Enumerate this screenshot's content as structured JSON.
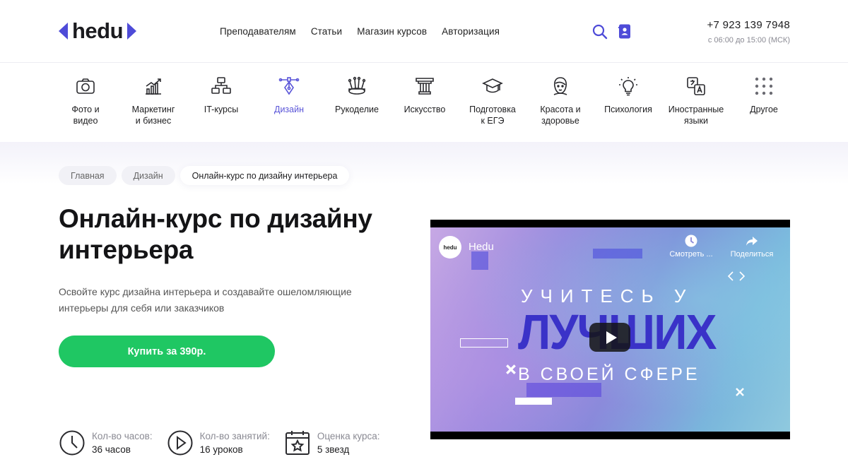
{
  "header": {
    "logo_text": "hedu",
    "nav": [
      "Преподавателям",
      "Статьи",
      "Магазин курсов",
      "Авторизация"
    ],
    "phone": "+7 923 139 7948",
    "hours": "с 06:00 до 15:00 (МСК)",
    "accent_color": "#4e4bd8"
  },
  "categories": [
    {
      "label": "Фото и\nвидео",
      "icon": "camera-icon"
    },
    {
      "label": "Маркетинг\nи бизнес",
      "icon": "growth-chart-icon"
    },
    {
      "label": "IT-курсы",
      "icon": "network-icon"
    },
    {
      "label": "Дизайн",
      "icon": "pen-tool-icon",
      "active": true
    },
    {
      "label": "Рукоделие",
      "icon": "sewing-icon"
    },
    {
      "label": "Искусство",
      "icon": "column-icon"
    },
    {
      "label": "Подготовка\nк ЕГЭ",
      "icon": "graduation-cap-icon"
    },
    {
      "label": "Красота и\nздоровье",
      "icon": "face-icon"
    },
    {
      "label": "Психология",
      "icon": "lightbulb-icon"
    },
    {
      "label": "Иностранные\nязыки",
      "icon": "translate-icon"
    },
    {
      "label": "Другое",
      "icon": "grid-dots-icon"
    }
  ],
  "breadcrumb": [
    "Главная",
    "Дизайн",
    "Онлайн-курс по дизайну интерьера"
  ],
  "hero": {
    "title": "Онлайн-курс по дизайну интерьера",
    "subtitle": "Освойте курс дизайна интерьера и создавайте ошеломляющие интерьеры для себя или заказчиков",
    "buy_label": "Купить за 390р.",
    "buy_color": "#1fc763"
  },
  "stats": [
    {
      "key": "Кол-во часов:",
      "value": "36 часов",
      "icon": "clock-icon"
    },
    {
      "key": "Кол-во занятий:",
      "value": "16 уроков",
      "icon": "play-circle-icon"
    },
    {
      "key": "Оценка курса:",
      "value": "5 звезд",
      "icon": "calendar-star-icon"
    }
  ],
  "video": {
    "channel_logo": "hedu",
    "channel": "Hedu",
    "watch_later": "Смотреть ...",
    "share": "Поделиться",
    "line1": "УЧИТЕСЬ У",
    "line2": "ЛУЧШИХ",
    "line3": "В СВОЕЙ СФЕРЕ"
  }
}
